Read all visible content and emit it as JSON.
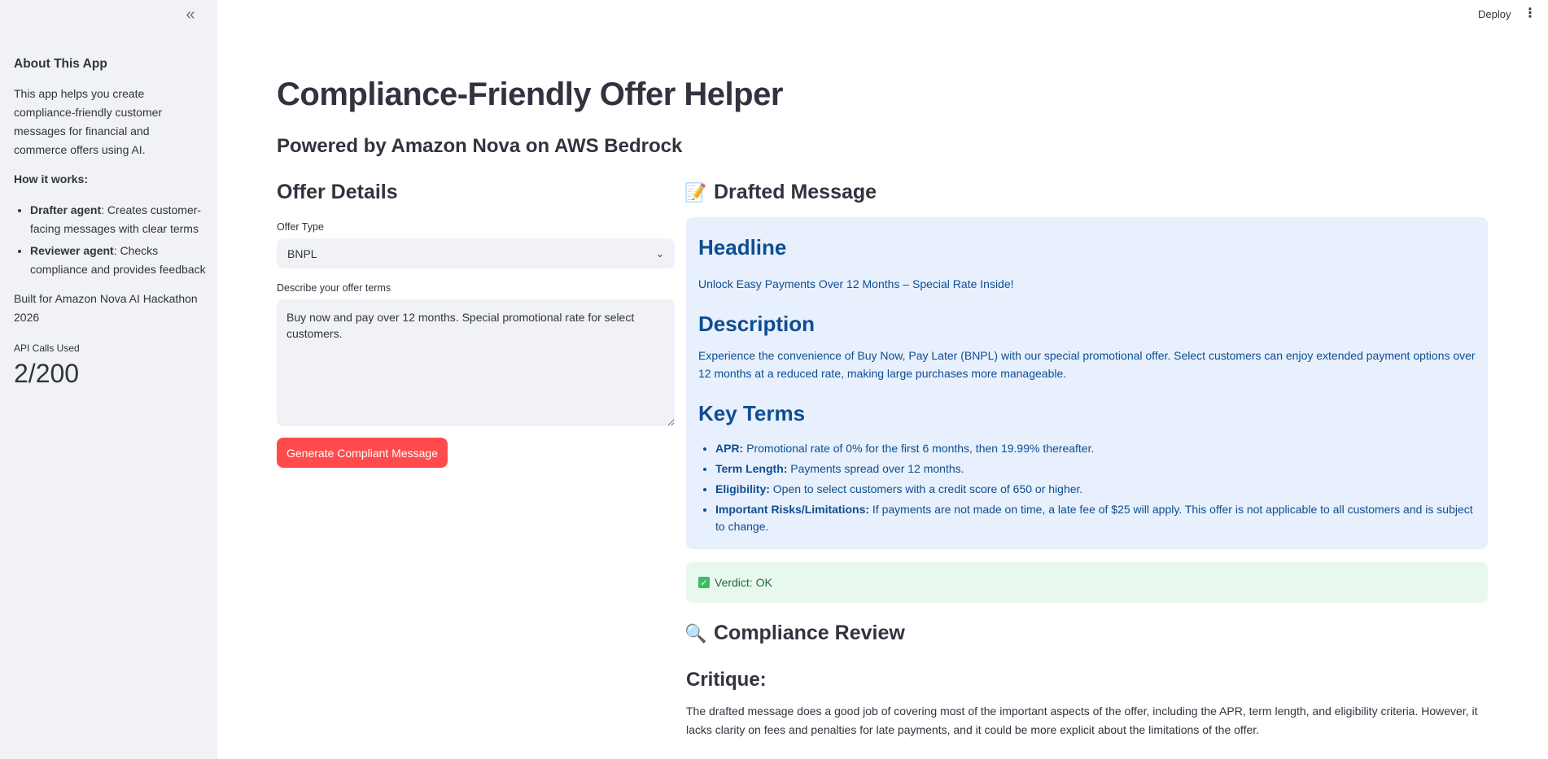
{
  "sidebar": {
    "collapse_icon": "double-chevron-left-icon",
    "title": "About This App",
    "intro": "This app helps you create compliance-friendly customer messages for financial and commerce offers using AI.",
    "how_it_works": "How it works:",
    "items": [
      {
        "term": "Drafter agent",
        "desc": ": Creates customer-facing messages with clear terms"
      },
      {
        "term": "Reviewer agent",
        "desc": ": Checks compliance and provides feedback"
      }
    ],
    "built_for": "Built for Amazon Nova AI Hackathon 2026",
    "metric": {
      "label": "API Calls Used",
      "value": "2/200"
    }
  },
  "header": {
    "deploy_label": "Deploy",
    "menu_icon": "kebab-menu-icon"
  },
  "main": {
    "title": "Compliance-Friendly Offer Helper",
    "subtitle": "Powered by Amazon Nova on AWS Bedrock",
    "offer_details": {
      "heading": "Offer Details",
      "offer_type_label": "Offer Type",
      "offer_type_value": "BNPL",
      "terms_label": "Describe your offer terms",
      "terms_value": "Buy now and pay over 12 months. Special promotional rate for select customers.",
      "generate_label": "Generate Compliant Message"
    },
    "drafted": {
      "heading": "Drafted Message",
      "icon": "memo-icon",
      "headline_h": "Headline",
      "headline": "Unlock Easy Payments Over 12 Months – Special Rate Inside!",
      "description_h": "Description",
      "description": "Experience the convenience of Buy Now, Pay Later (BNPL) with our special promotional offer. Select customers can enjoy extended payment options over 12 months at a reduced rate, making large purchases more manageable.",
      "key_terms_h": "Key Terms",
      "key_terms": [
        {
          "term": "APR:",
          "text": " Promotional rate of 0% for the first 6 months, then 19.99% thereafter."
        },
        {
          "term": "Term Length:",
          "text": " Payments spread over 12 months."
        },
        {
          "term": "Eligibility:",
          "text": " Open to select customers with a credit score of 650 or higher."
        },
        {
          "term": "Important Risks/Limitations:",
          "text": " If payments are not made on time, a late fee of $25 will apply. This offer is not applicable to all customers and is subject to change."
        }
      ]
    },
    "verdict": {
      "text": "Verdict: OK",
      "icon": "check-mark-icon",
      "color": "#3dbb64"
    },
    "review": {
      "heading": "Compliance Review",
      "icon": "magnifying-glass-icon",
      "critique_h": "Critique:",
      "critique": "The drafted message does a good job of covering most of the important aspects of the offer, including the APR, term length, and eligibility criteria. However, it lacks clarity on fees and penalties for late payments, and it could be more explicit about the limitations of the offer."
    }
  },
  "colors": {
    "accent": "#ff4b4b",
    "info_bg": "#e7f0fc",
    "info_text": "#0f4d92",
    "success_bg": "#e8f8ec",
    "sidebar_bg": "#f0f2f6"
  }
}
